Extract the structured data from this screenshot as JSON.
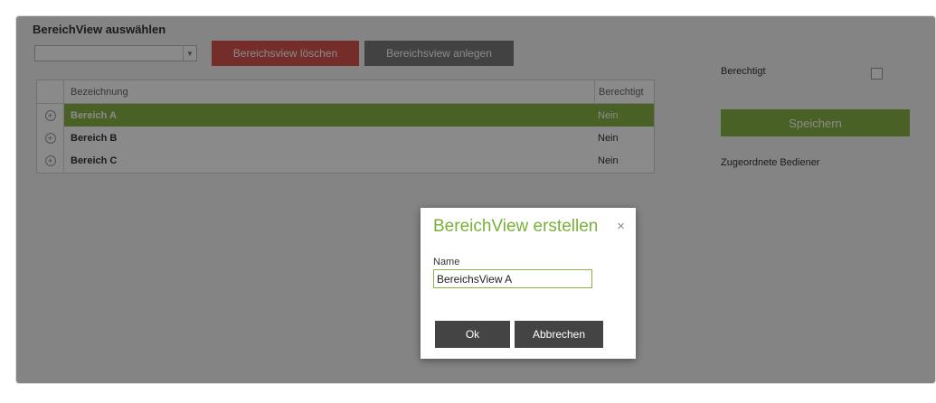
{
  "page": {
    "title": "BereichView auswählen"
  },
  "toolbar": {
    "select_value": "",
    "delete_label": "Bereichsview löschen",
    "create_label": "Bereichsview anlegen"
  },
  "table": {
    "columns": [
      "Bezeichnung",
      "Berechtigt"
    ],
    "rows": [
      {
        "name": "Bereich A",
        "berechtigt": "Nein",
        "selected": true
      },
      {
        "name": "Bereich B",
        "berechtigt": "Nein",
        "selected": false
      },
      {
        "name": "Bereich C",
        "berechtigt": "Nein",
        "selected": false
      }
    ]
  },
  "side": {
    "berechtigt_label": "Berechtigt",
    "save_label": "Speichern",
    "assigned_label": "Zugeordnete Bediener"
  },
  "modal": {
    "title": "BereichView erstellen",
    "close_glyph": "×",
    "name_label": "Name",
    "name_value": "BereichsView A",
    "ok_label": "Ok",
    "cancel_label": "Abbrechen"
  },
  "colors": {
    "accent_green": "#8ab446",
    "danger_red": "#d9534f",
    "modal_title_green": "#7ab03a"
  }
}
